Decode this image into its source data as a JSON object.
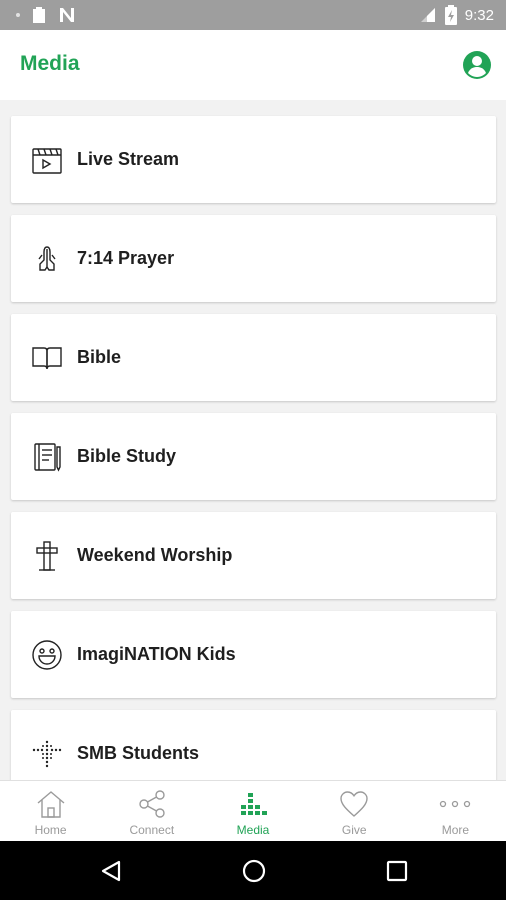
{
  "status": {
    "time": "9:32"
  },
  "header": {
    "title": "Media"
  },
  "items": [
    {
      "label": "Live Stream",
      "icon": "live-stream-icon"
    },
    {
      "label": "7:14 Prayer",
      "icon": "praying-hands-icon"
    },
    {
      "label": "Bible",
      "icon": "open-book-icon"
    },
    {
      "label": "Bible Study",
      "icon": "notebook-icon"
    },
    {
      "label": "Weekend Worship",
      "icon": "cross-icon"
    },
    {
      "label": "ImagiNATION Kids",
      "icon": "smiley-icon"
    },
    {
      "label": "SMB Students",
      "icon": "dotted-cross-icon"
    }
  ],
  "tabs": [
    {
      "label": "Home",
      "icon": "home-icon"
    },
    {
      "label": "Connect",
      "icon": "share-icon"
    },
    {
      "label": "Media",
      "icon": "media-bars-icon"
    },
    {
      "label": "Give",
      "icon": "heart-icon"
    },
    {
      "label": "More",
      "icon": "more-dots-icon"
    }
  ],
  "colors": {
    "accent": "#21a356",
    "text": "#1f1f1f",
    "inactive": "#9a9a9a"
  }
}
